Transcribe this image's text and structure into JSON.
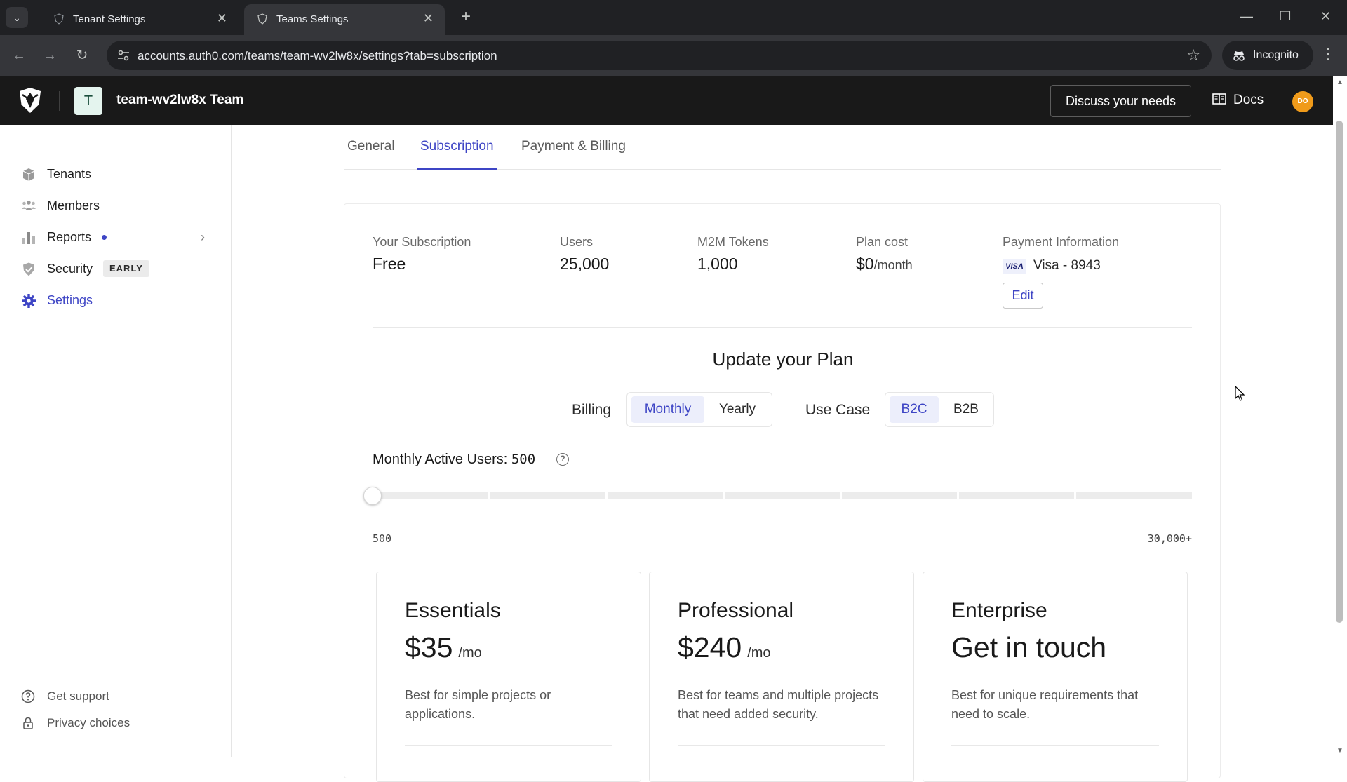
{
  "browser": {
    "tabs": [
      {
        "title": "Tenant Settings",
        "active": false
      },
      {
        "title": "Teams Settings",
        "active": true
      }
    ],
    "url": "accounts.auth0.com/teams/team-wv2lw8x/settings?tab=subscription",
    "incognito_label": "Incognito"
  },
  "header": {
    "team_initial": "T",
    "team_name": "team-wv2lw8x Team",
    "discuss_label": "Discuss your needs",
    "docs_label": "Docs",
    "user_initials": "DO"
  },
  "sidebar": {
    "items": [
      {
        "label": "Tenants",
        "icon": "box-icon"
      },
      {
        "label": "Members",
        "icon": "people-icon"
      },
      {
        "label": "Reports",
        "icon": "bar-chart-icon"
      },
      {
        "label": "Security",
        "icon": "shield-check-icon",
        "badge": "EARLY"
      },
      {
        "label": "Settings",
        "icon": "gear-icon",
        "active": true
      }
    ],
    "footer": [
      {
        "label": "Get support",
        "icon": "help-circle-icon"
      },
      {
        "label": "Privacy choices",
        "icon": "lock-icon"
      }
    ]
  },
  "tabs": [
    "General",
    "Subscription",
    "Payment & Billing"
  ],
  "summary": {
    "subscription_label": "Your Subscription",
    "subscription_value": "Free",
    "users_label": "Users",
    "users_value": "25,000",
    "m2m_label": "M2M Tokens",
    "m2m_value": "1,000",
    "cost_label": "Plan cost",
    "cost_value": "$0",
    "cost_period": "/month",
    "payment_label": "Payment Information",
    "card_brand": "VISA",
    "card_text": "Visa - 8943",
    "edit_label": "Edit"
  },
  "update": {
    "title": "Update your Plan",
    "billing_label": "Billing",
    "billing_options": [
      "Monthly",
      "Yearly"
    ],
    "billing_selected": "Monthly",
    "use_case_label": "Use Case",
    "use_case_options": [
      "B2C",
      "B2B"
    ],
    "use_case_selected": "B2C",
    "mau_label": "Monthly Active Users:",
    "mau_value": "500",
    "range_min": "500",
    "range_max": "30,000+",
    "slider_level": 0
  },
  "plans": [
    {
      "name": "Essentials",
      "price": "$35",
      "period": "/mo",
      "description": "Best for simple projects or applications."
    },
    {
      "name": "Professional",
      "price": "$240",
      "period": "/mo",
      "description": "Best for teams and multiple projects that need added security."
    },
    {
      "name": "Enterprise",
      "price": "Get in touch",
      "period": "",
      "description": "Best for unique requirements that need to scale."
    }
  ],
  "colors": {
    "accent": "#3e45c5",
    "header_bg": "#191919",
    "chrome_bg": "#202124",
    "avatar": "#f09b1a"
  }
}
